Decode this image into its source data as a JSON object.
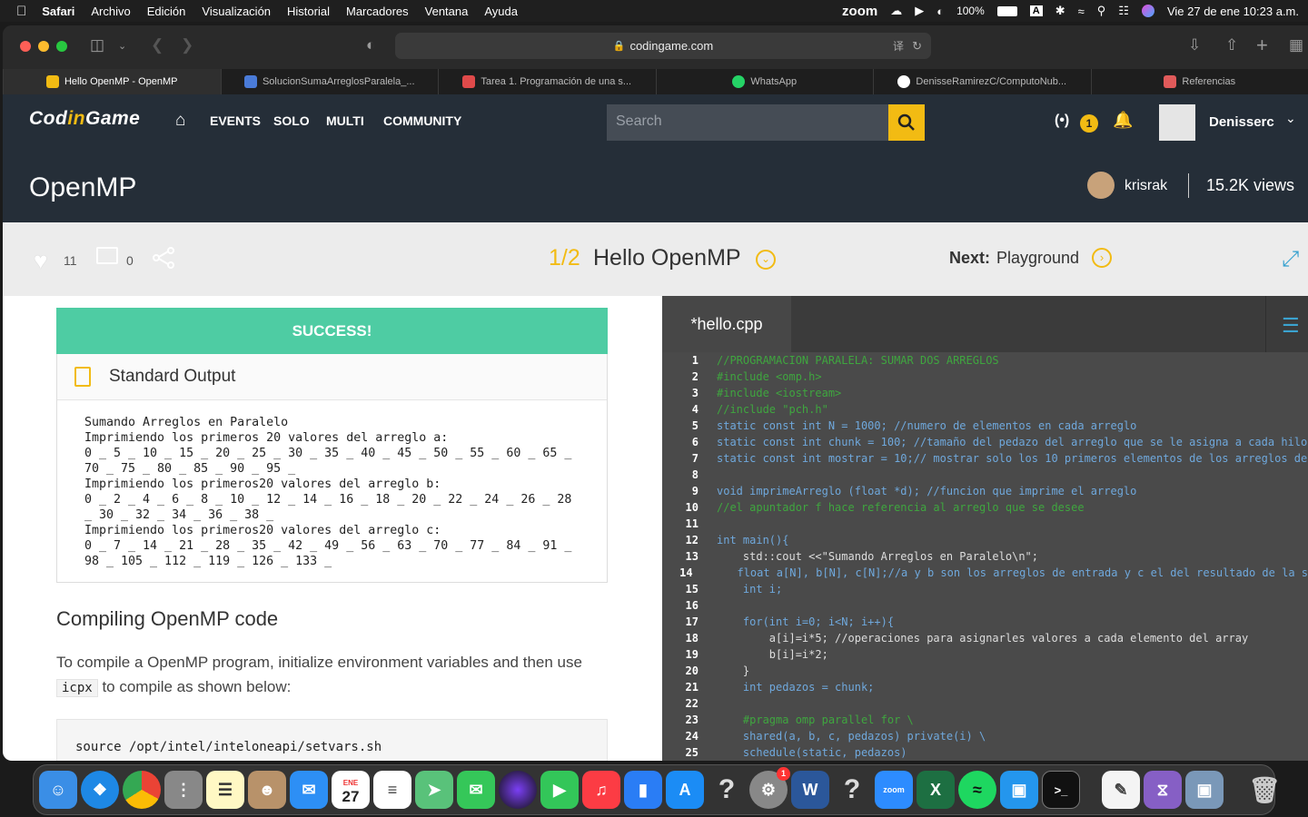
{
  "menubar": {
    "items": [
      "Safari",
      "Archivo",
      "Edición",
      "Visualización",
      "Historial",
      "Marcadores",
      "Ventana",
      "Ayuda"
    ],
    "zoom": "zoom",
    "battery": "100%",
    "input_source": "A",
    "datetime": "Vie 27 de ene  10:23 a.m."
  },
  "browser": {
    "url": "codingame.com",
    "tabs": [
      {
        "label": "Hello OpenMP - OpenMP",
        "color": "#f2bb13"
      },
      {
        "label": "SolucionSumaArreglosParalela_...",
        "color": "#4a7bd8"
      },
      {
        "label": "Tarea 1. Programación de una s...",
        "color": "#e04a4a"
      },
      {
        "label": "WhatsApp",
        "color": "#25d366"
      },
      {
        "label": "DenisseRamirezC/ComputoNub...",
        "color": "#ffffff"
      },
      {
        "label": "Referencias",
        "color": "#e05a5a"
      }
    ]
  },
  "cg_nav": {
    "logo_a": "Cod",
    "logo_b": "in",
    "logo_c": "Game",
    "items": [
      "EVENTS",
      "SOLO",
      "MULTI",
      "COMMUNITY"
    ],
    "search_placeholder": "Search",
    "notif_count": "1",
    "username": "Denisserc"
  },
  "page": {
    "title": "OpenMP",
    "author": "krisrak",
    "views": "15.2K views"
  },
  "lesson": {
    "likes": "11",
    "comments": "0",
    "progress": "1/2",
    "lesson_title": "Hello OpenMP",
    "next_label": "Next:",
    "next_title": "Playground"
  },
  "output": {
    "status": "SUCCESS!",
    "header": "Standard Output",
    "lines": [
      "Sumando Arreglos en Paralelo",
      "Imprimiendo los primeros 20 valores del arreglo a:",
      "0 _ 5 _ 10 _ 15 _ 20 _ 25 _ 30 _ 35 _ 40 _ 45 _ 50 _ 55 _ 60 _ 65 _",
      "70 _ 75 _ 80 _ 85 _ 90 _ 95 _",
      "Imprimiendo los primeros20 valores del arreglo b:",
      "0 _ 2 _ 4 _ 6 _ 8 _ 10 _ 12 _ 14 _ 16 _ 18 _ 20 _ 22 _ 24 _ 26 _ 28",
      "_ 30 _ 32 _ 34 _ 36 _ 38 _",
      "Imprimiendo los primeros20 valores del arreglo c:",
      "0 _ 7 _ 14 _ 21 _ 28 _ 35 _ 42 _ 49 _ 56 _ 63 _ 70 _ 77 _ 84 _ 91 _",
      "98 _ 105 _ 112 _ 119 _ 126 _ 133 _"
    ]
  },
  "article": {
    "heading": "Compiling OpenMP code",
    "para_a": "To compile a OpenMP program, initialize environment variables and then use ",
    "para_code": "icpx",
    "para_b": " to compile as shown below:",
    "command": "source /opt/intel/inteloneapi/setvars.sh"
  },
  "editor": {
    "filename": "*hello.cpp",
    "lines": [
      "//PROGRAMACION PARALELA: SUMAR DOS ARREGLOS",
      "#include <omp.h>",
      "#include <iostream>",
      "//include \"pch.h\"",
      "static const int N = 1000; //numero de elementos en cada arreglo",
      "static const int chunk = 100; //tamaño del pedazo del arreglo que se le asigna a cada hilo",
      "static const int mostrar = 10;// mostrar solo los 10 primeros elementos de los arreglos de",
      "",
      "void imprimeArreglo (float *d); //funcion que imprime el arreglo",
      "//el apuntador f hace referencia al arreglo que se desee",
      "",
      "int main(){",
      "    std::cout <<\"Sumando Arreglos en Paralelo\\n\";",
      "    float a[N], b[N], c[N];//a y b son los arreglos de entrada y c el del resultado de la s",
      "    int i;",
      "",
      "    for(int i=0; i<N; i++){",
      "        a[i]=i*5; //operaciones para asignarles valores a cada elemento del array",
      "        b[i]=i*2;",
      "    }",
      "    int pedazos = chunk;",
      "",
      "    #pragma omp parallel for \\",
      "    shared(a, b, c, pedazos) private(i) \\",
      "    schedule(static, pedazos)"
    ]
  },
  "dock": {
    "calendar_month": "ENE",
    "calendar_day": "27",
    "settings_badge": "1",
    "zoom_label": "zoom"
  }
}
